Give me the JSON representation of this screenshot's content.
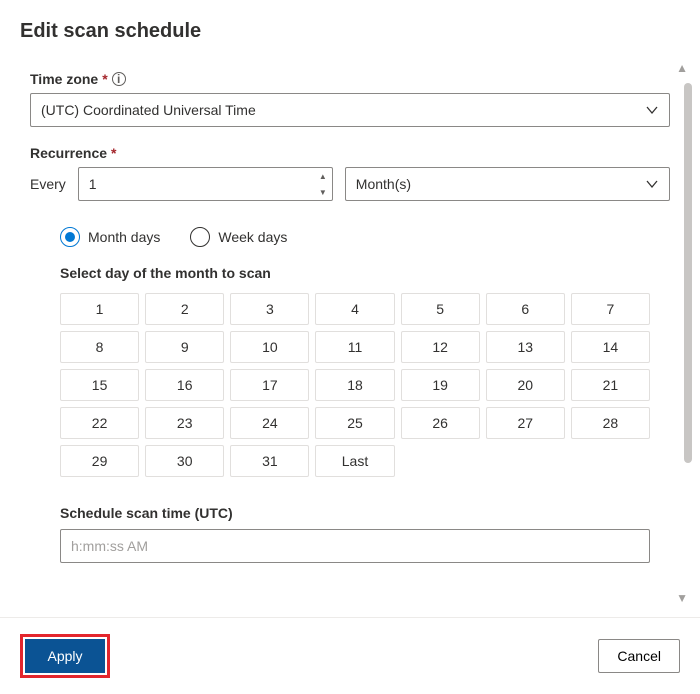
{
  "title": "Edit scan schedule",
  "timezone": {
    "label": "Time zone",
    "value": "(UTC) Coordinated Universal Time"
  },
  "recurrence": {
    "label": "Recurrence",
    "every_label": "Every",
    "count": "1",
    "unit": "Month(s)"
  },
  "day_type": {
    "month_days": "Month days",
    "week_days": "Week days",
    "selected": "month_days"
  },
  "select_day_label": "Select day of the month to scan",
  "days": [
    "1",
    "2",
    "3",
    "4",
    "5",
    "6",
    "7",
    "8",
    "9",
    "10",
    "11",
    "12",
    "13",
    "14",
    "15",
    "16",
    "17",
    "18",
    "19",
    "20",
    "21",
    "22",
    "23",
    "24",
    "25",
    "26",
    "27",
    "28",
    "29",
    "30",
    "31",
    "Last"
  ],
  "time": {
    "label": "Schedule scan time (UTC)",
    "placeholder": "h:mm:ss AM"
  },
  "buttons": {
    "apply": "Apply",
    "cancel": "Cancel"
  }
}
